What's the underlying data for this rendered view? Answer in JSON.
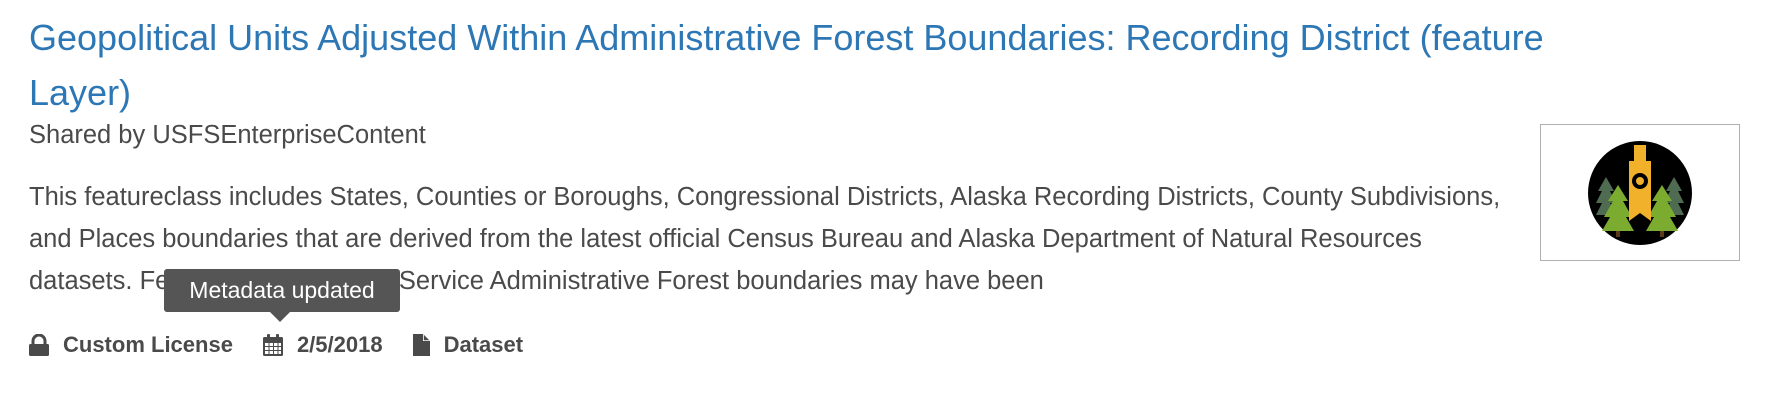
{
  "item": {
    "title": "Geopolitical Units Adjusted Within Administrative Forest Boundaries: Recording District (feature Layer)",
    "shared_by": "Shared by USFSEnterpriseContent",
    "description": "This featureclass includes States, Counties or Boroughs, Congressional Districts, Alaska Recording Districts, County Subdivisions, and Places boundaries that are derived from the latest official Census Bureau and Alaska Department of Natural Resources datasets. Features within Forest Service Administrative Forest boundaries may have been",
    "thumbnail_icon": "forest-service-badge-icon"
  },
  "tooltip": {
    "text": "Metadata updated"
  },
  "meta": {
    "license": {
      "label": "Custom License",
      "icon": "lock-icon"
    },
    "date": {
      "label": "2/5/2018",
      "icon": "calendar-icon"
    },
    "type": {
      "label": "Dataset",
      "icon": "file-icon"
    }
  },
  "colors": {
    "title": "#2d77b5",
    "text": "#4a4a4a",
    "tooltip_bg": "#555555",
    "badge_gold": "#f2b12b",
    "badge_green": "#7bab2f",
    "badge_dark": "#000000"
  }
}
